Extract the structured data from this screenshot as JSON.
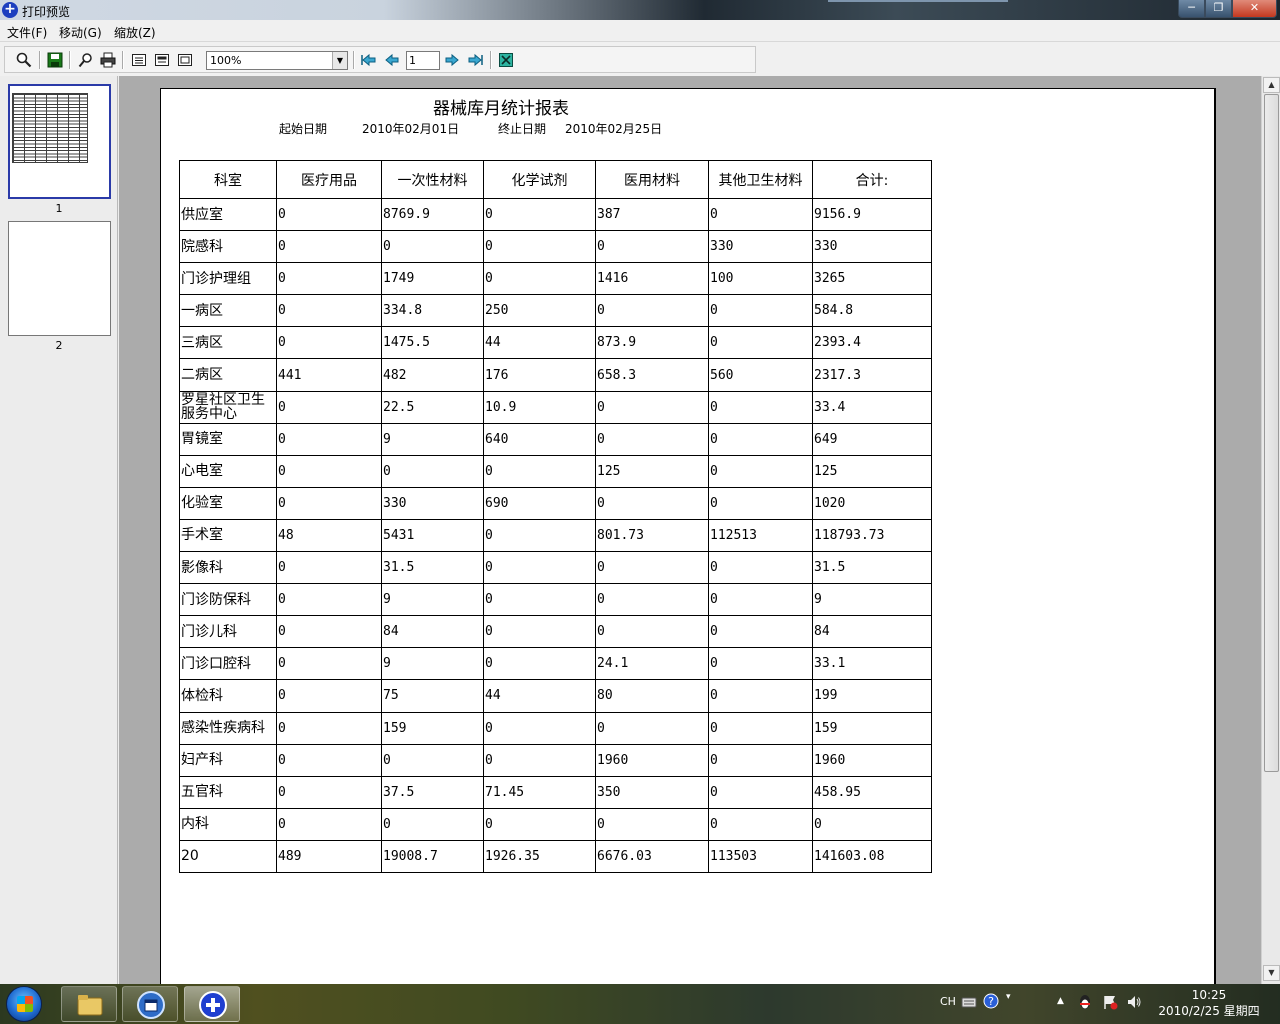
{
  "window": {
    "title": "打印预览"
  },
  "menu": [
    "文件(F)",
    "移动(G)",
    "缩放(Z)"
  ],
  "toolbar": {
    "zoom_value": "100%",
    "page_value": "1"
  },
  "thumbnails": [
    {
      "label": "1"
    },
    {
      "label": "2"
    }
  ],
  "report": {
    "title": "器械库月统计报表",
    "start_label": "起始日期",
    "start_date": "2010年02月01日",
    "end_label": "终止日期",
    "end_date": "2010年02月25日",
    "headers": [
      "科室",
      "医疗用品",
      "一次性材料",
      "化学试剂",
      "医用材料",
      "其他卫生材料",
      "合计:"
    ],
    "rows": [
      [
        "供应室",
        "0",
        "8769.9",
        "0",
        "387",
        "0",
        "9156.9"
      ],
      [
        "院感科",
        "0",
        "0",
        "0",
        "0",
        "330",
        "330"
      ],
      [
        "门诊护理组",
        "0",
        "1749",
        "0",
        "1416",
        "100",
        "3265"
      ],
      [
        "一病区",
        "0",
        "334.8",
        "250",
        "0",
        "0",
        "584.8"
      ],
      [
        "三病区",
        "0",
        "1475.5",
        "44",
        "873.9",
        "0",
        "2393.4"
      ],
      [
        "二病区",
        "441",
        "482",
        "176",
        "658.3",
        "560",
        "2317.3"
      ],
      [
        "罗星社区卫生服务中心",
        "0",
        "22.5",
        "10.9",
        "0",
        "0",
        "33.4"
      ],
      [
        "胃镜室",
        "0",
        "9",
        "640",
        "0",
        "0",
        "649"
      ],
      [
        "心电室",
        "0",
        "0",
        "0",
        "125",
        "0",
        "125"
      ],
      [
        "化验室",
        "0",
        "330",
        "690",
        "0",
        "0",
        "1020"
      ],
      [
        "手术室",
        "48",
        "5431",
        "0",
        "801.73",
        "112513",
        "118793.73"
      ],
      [
        "影像科",
        "0",
        "31.5",
        "0",
        "0",
        "0",
        "31.5"
      ],
      [
        "门诊防保科",
        "0",
        "9",
        "0",
        "0",
        "0",
        "9"
      ],
      [
        "门诊儿科",
        "0",
        "84",
        "0",
        "0",
        "0",
        "84"
      ],
      [
        "门诊口腔科",
        "0",
        "9",
        "0",
        "24.1",
        "0",
        "33.1"
      ],
      [
        "体检科",
        "0",
        "75",
        "44",
        "80",
        "0",
        "199"
      ],
      [
        "感染性疾病科",
        "0",
        "159",
        "0",
        "0",
        "0",
        "159"
      ],
      [
        "妇产科",
        "0",
        "0",
        "0",
        "1960",
        "0",
        "1960"
      ],
      [
        "五官科",
        "0",
        "37.5",
        "71.45",
        "350",
        "0",
        "458.95"
      ],
      [
        "内科",
        "0",
        "0",
        "0",
        "0",
        "0",
        "0"
      ],
      [
        "20",
        "489",
        "19008.7",
        "1926.35",
        "6676.03",
        "113503",
        "141603.08"
      ]
    ]
  },
  "taskbar": {
    "tray_lang": "CH",
    "clock_time": "10:25",
    "clock_date": "2010/2/25 星期四"
  }
}
